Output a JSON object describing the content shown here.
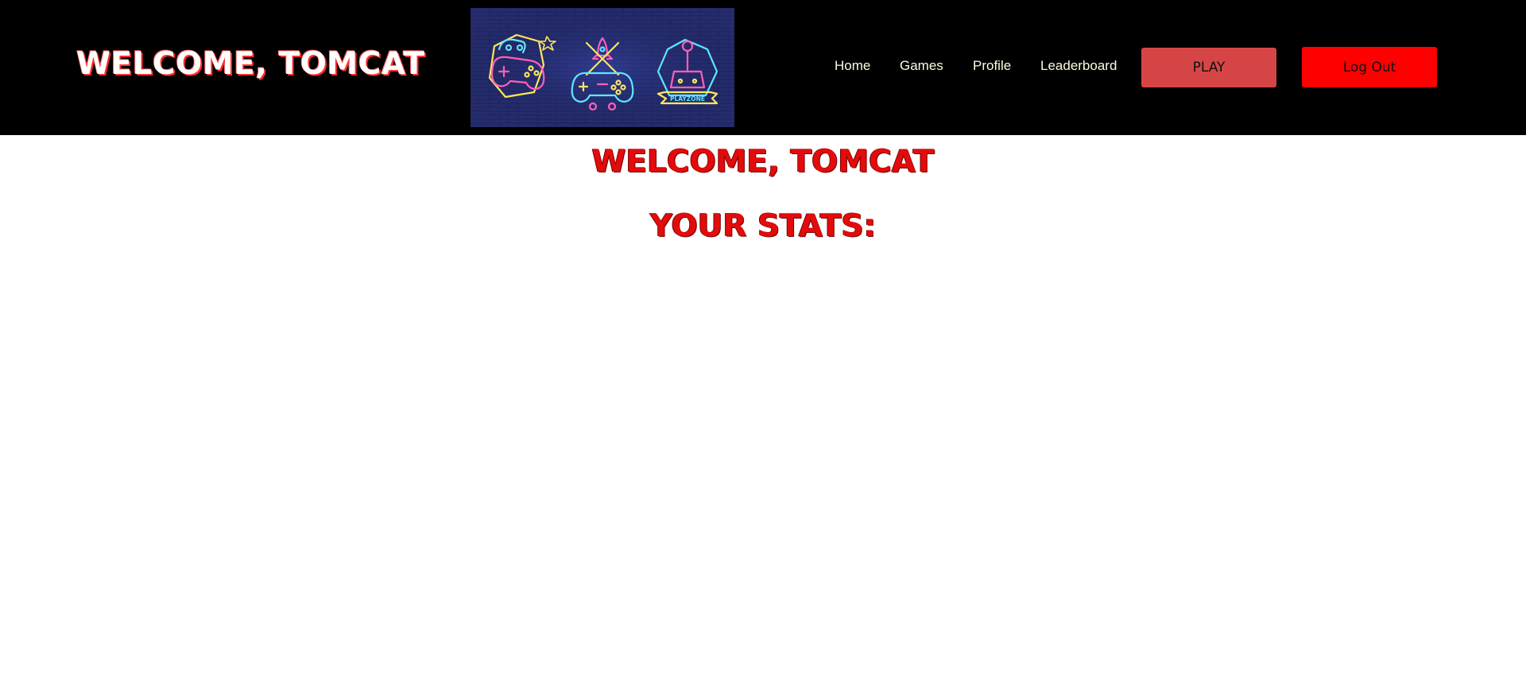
{
  "header": {
    "brand_title": "WELCOME, TOMCAT",
    "banner": {
      "description_icons": [
        "gamepad-icon",
        "rocket-controller-icon",
        "joystick-icon"
      ],
      "sign_text": "PLAYZONE"
    },
    "nav": [
      {
        "label": "Home",
        "icon": ""
      },
      {
        "label": "Games",
        "icon": ""
      },
      {
        "label": "Profile",
        "icon": ""
      },
      {
        "label": "Leaderboard",
        "icon": ""
      }
    ],
    "play_label": "PLAY",
    "logout_label": "Log Out"
  },
  "main": {
    "welcome_heading": "WELCOME, TOMCAT",
    "stats_heading": "YOUR STATS:"
  },
  "colors": {
    "header_bg": "#000000",
    "play_button": "#d64545",
    "logout_button": "#ff0000",
    "heading_red": "#e30b0b",
    "neon_pink": "#ff5fb8",
    "neon_yellow": "#ffe65c",
    "neon_cyan": "#5fe6ff",
    "brick_bg": "#1d2258"
  }
}
